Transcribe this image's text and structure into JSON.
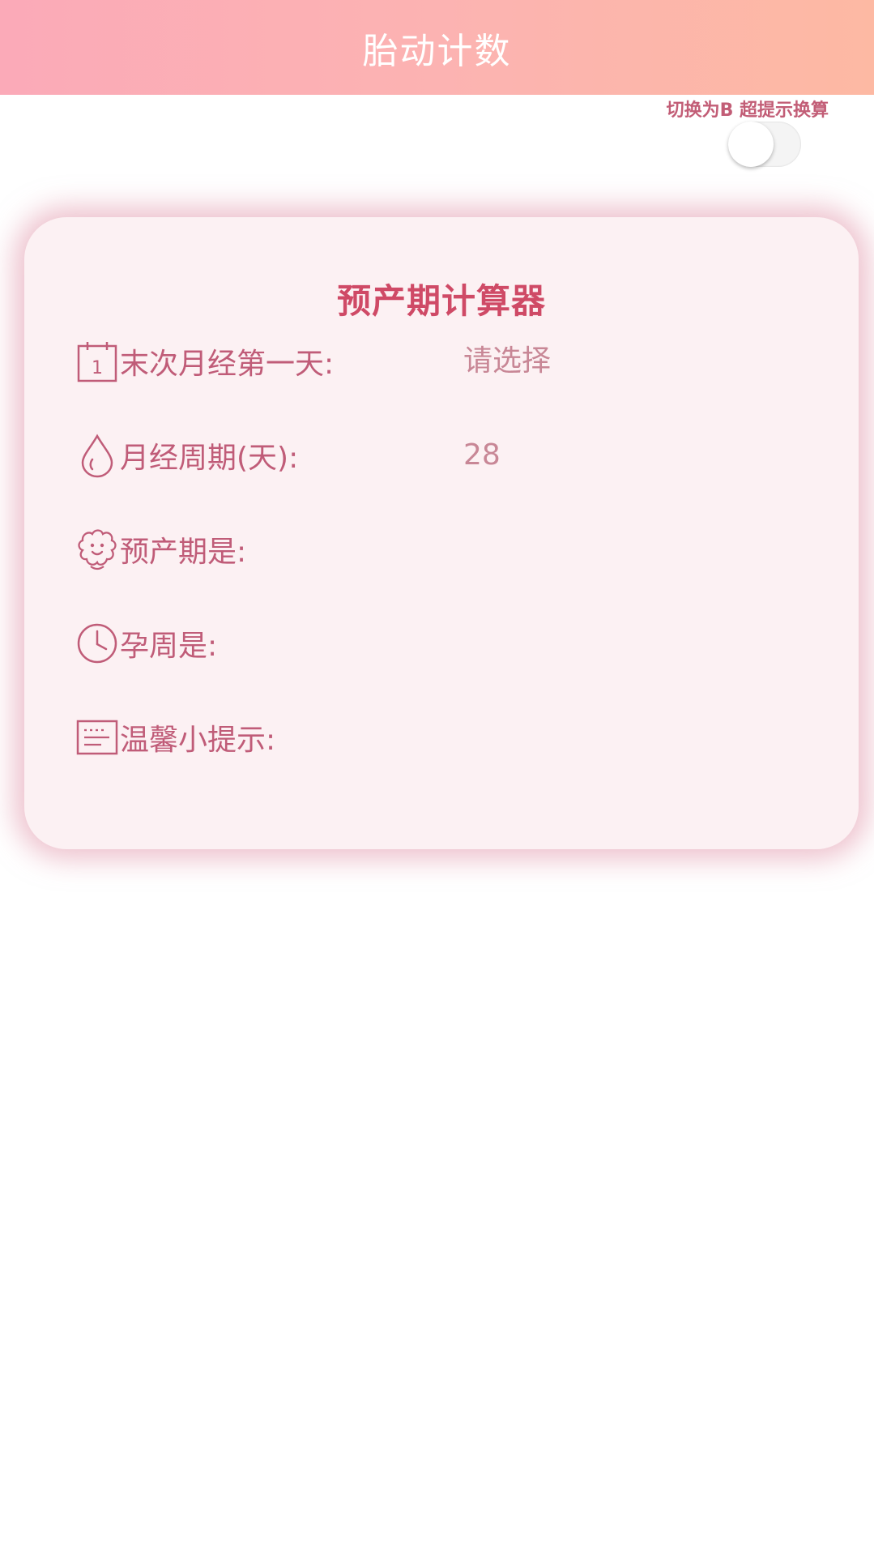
{
  "header": {
    "title": "胎动计数"
  },
  "switch": {
    "label": "切换为B 超提示换算",
    "state": "off"
  },
  "card": {
    "title": "预产期计算器",
    "rows": [
      {
        "icon": "calendar-icon",
        "label": "末次月经第一天:",
        "value": "请选择"
      },
      {
        "icon": "drop-icon",
        "label": "月经周期(天):",
        "value": "28"
      },
      {
        "icon": "baby-face-icon",
        "label": "预产期是:",
        "value": ""
      },
      {
        "icon": "clock-icon",
        "label": "孕周是:",
        "value": ""
      },
      {
        "icon": "note-icon",
        "label": "温馨小提示:",
        "value": ""
      }
    ]
  },
  "colors": {
    "header_gradient_start": "#fbaab8",
    "header_gradient_end": "#fdb9a3",
    "accent_text": "#c05c78",
    "title_text": "#cf4a66",
    "card_bg": "#fcf1f3",
    "card_glow": "#de8ca2"
  }
}
